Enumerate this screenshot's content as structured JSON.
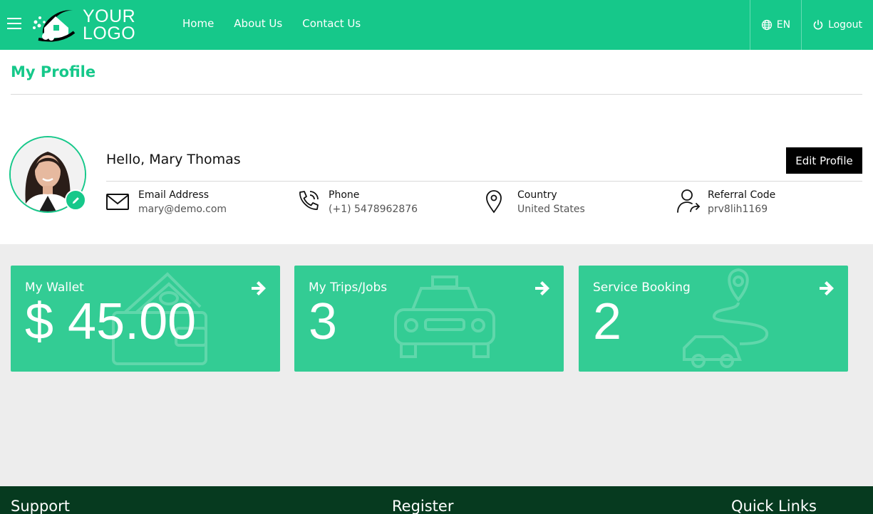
{
  "header": {
    "logo_line1": "YOUR",
    "logo_line2": "LOGO",
    "nav": [
      "Home",
      "About Us",
      "Contact Us"
    ],
    "language": "EN",
    "logout": "Logout"
  },
  "profile": {
    "page_title": "My Profile",
    "greeting": "Hello, Mary Thomas",
    "edit_button": "Edit Profile",
    "info": [
      {
        "label": "Email Address",
        "value": "mary@demo.com",
        "icon": "envelope-icon"
      },
      {
        "label": "Phone",
        "value": "(+1) 5478962876",
        "icon": "phone-icon"
      },
      {
        "label": "Country",
        "value": "United States",
        "icon": "location-pin-icon"
      },
      {
        "label": "Referral Code",
        "value": "prv8lih1169",
        "icon": "user-share-icon"
      }
    ]
  },
  "cards": [
    {
      "label": "My Wallet",
      "value": "$ 45.00",
      "icon": "wallet-icon"
    },
    {
      "label": "My Trips/Jobs",
      "value": "3",
      "icon": "taxi-icon"
    },
    {
      "label": "Service Booking",
      "value": "2",
      "icon": "route-car-icon"
    }
  ],
  "footer": {
    "headings": [
      "Support",
      "Register",
      "Quick Links"
    ]
  },
  "colors": {
    "brand": "#16c88a",
    "card": "#33cc94",
    "footer": "#063a1f"
  }
}
